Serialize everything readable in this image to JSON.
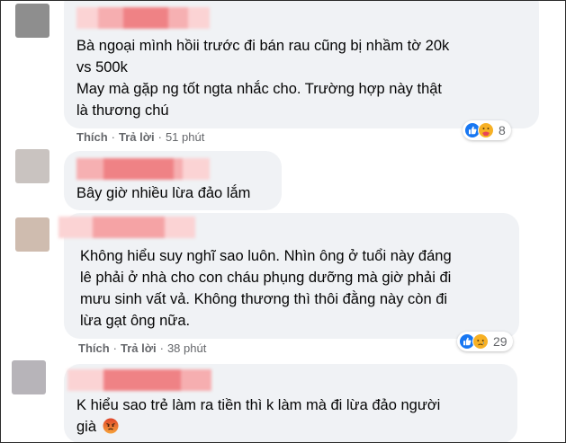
{
  "colors": {
    "bubble_bg": "#f0f2f5",
    "action_text": "#65676b",
    "like_blue": "#1877f2",
    "reaction_yellow": "#f7b125",
    "blur_pink": "#f08a8c"
  },
  "icons": {
    "like": "like-reaction-icon",
    "care": "care-reaction-icon",
    "sad": "sad-reaction-icon",
    "angry": "angry-emoji-icon"
  },
  "comments": [
    {
      "text": "Bà ngoại mình hồii trước đi bán rau cũng bị nhầm tờ 20k\nvs 500k\nMay mà gặp ng tốt ngta nhắc cho. Trường hợp này thật\nlà thương chú",
      "like_label": "Thích",
      "reply_label": "Trả lời",
      "time": "51 phút",
      "reaction_count": "8"
    },
    {
      "text": "Bây giờ nhiều lừa đảo lắm"
    },
    {
      "text": "Không hiểu suy nghĩ sao luôn. Nhìn ông ở tuổi này đáng\nlê phải ở nhà cho con cháu phụng dưỡng mà giờ phải đi\nmưu sinh vất vả. Không thương thì thôi đằng này còn đi\nlừa gạt ông nữa.",
      "like_label": "Thích",
      "reply_label": "Trả lời",
      "time": "38 phút",
      "reaction_count": "29"
    },
    {
      "text": "K hiểu sao trẻ làm ra tiền thì k làm mà đi lừa đảo người\ngià"
    }
  ]
}
